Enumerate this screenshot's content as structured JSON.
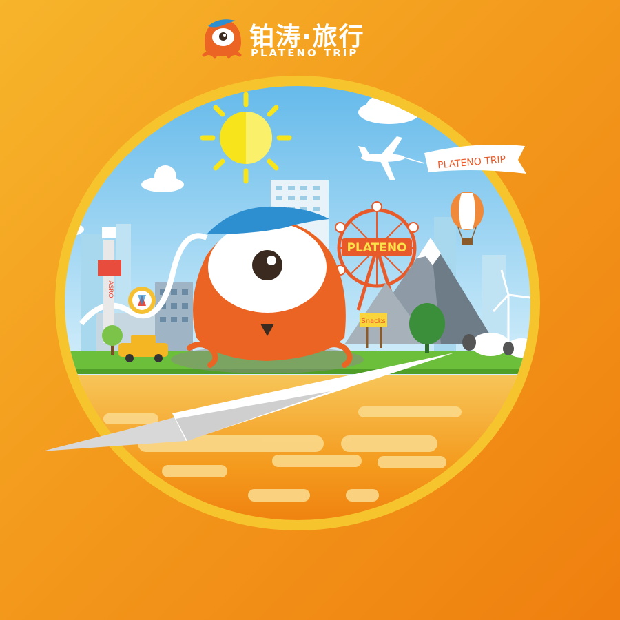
{
  "brand": {
    "name_cn": "铂涛·旅行",
    "name_en": "PLATENO TRIP"
  },
  "scene": {
    "banner_text": "PLATENO TRIP",
    "ferris_wheel_sign": "PLATENO",
    "snack_sign": "Snacks",
    "tower_sign": "ASRO"
  },
  "colors": {
    "background_light": "#f7b52b",
    "background_dark": "#ef7f0f",
    "mascot_orange": "#ec6423",
    "mascot_hat_blue": "#2e8fd0",
    "sky_blue": "#8fd0f0",
    "sun_yellow": "#f7e41b",
    "ground_sand": "#f8c561",
    "ground_orange": "#f08a14",
    "grass_green": "#6cbf3a"
  },
  "icons": {
    "logo_mark": "octopus-mascot-icon",
    "sun": "sun-icon",
    "airplane": "airplane-icon",
    "paper_plane": "paper-plane-icon",
    "balloon": "hot-air-balloon-icon",
    "ferris_wheel": "ferris-wheel-icon",
    "windmill": "wind-turbine-icon"
  }
}
